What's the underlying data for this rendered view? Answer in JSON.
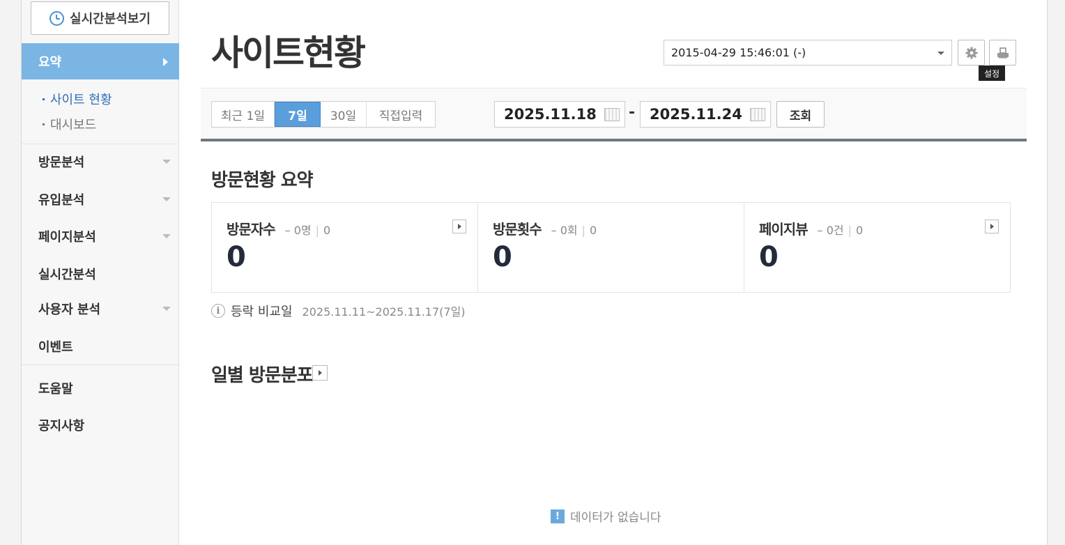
{
  "sidebar": {
    "realtime_button": "실시간분석보기",
    "summary": "요약",
    "submenu": [
      {
        "label": "사이트 현황",
        "active": true
      },
      {
        "label": "대시보드",
        "active": false
      }
    ],
    "items": [
      {
        "label": "방문분석",
        "expandable": true
      },
      {
        "label": "유입분석",
        "expandable": true
      },
      {
        "label": "페이지분석",
        "expandable": true
      },
      {
        "label": "실시간분석",
        "expandable": false
      },
      {
        "label": "사용자 분석",
        "expandable": true
      },
      {
        "label": "이벤트",
        "expandable": false
      }
    ],
    "bottom_items": [
      {
        "label": "도움말"
      },
      {
        "label": "공지사항"
      }
    ]
  },
  "header": {
    "title": "사이트현황",
    "date_select": "2015-04-29 15:46:01 (-)",
    "settings_icon": "gear-icon",
    "print_icon": "print-icon",
    "tooltip": "설정"
  },
  "filter": {
    "range_tabs": [
      {
        "label": "최근 1일",
        "active": false
      },
      {
        "label": "7일",
        "active": true
      },
      {
        "label": "30일",
        "active": false
      },
      {
        "label": "직접입력",
        "active": false
      }
    ],
    "start_date": "2025.11.18",
    "end_date": "2025.11.24",
    "separator": "-",
    "query_button": "조회"
  },
  "summary": {
    "title": "방문현황 요약",
    "stats": [
      {
        "label": "방문자수",
        "sub_a": "0명",
        "sub_b": "0",
        "value": "0"
      },
      {
        "label": "방문횟수",
        "sub_a": "0회",
        "sub_b": "0",
        "value": "0"
      },
      {
        "label": "페이지뷰",
        "sub_a": "0건",
        "sub_b": "0",
        "value": "0"
      }
    ],
    "compare_label": "등락 비교일",
    "compare_value": "2025.11.11~2025.11.17(7일)"
  },
  "daily": {
    "title": "일별 방문분포",
    "no_data": "데이터가 없습니다"
  },
  "colors": {
    "accent": "#7bb5e4",
    "tab_active": "#5a9edc",
    "active_link": "#2f6fb6"
  }
}
